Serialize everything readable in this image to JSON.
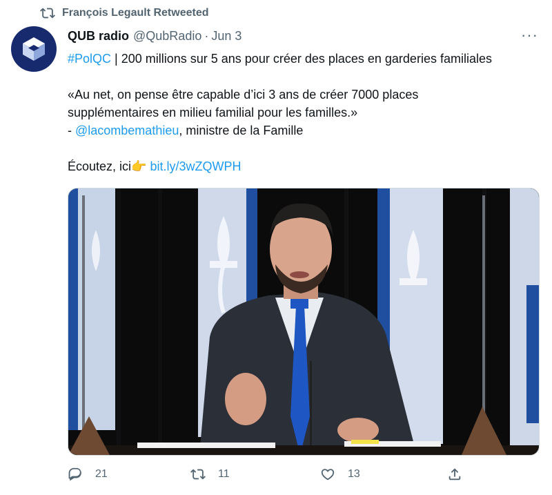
{
  "retweet": {
    "text": "François Legault Retweeted",
    "icon": "retweet-icon"
  },
  "author": {
    "name": "QUB radio",
    "handle": "@QubRadio",
    "separator": "·",
    "date": "Jun 3"
  },
  "tweet": {
    "line1_hashtag": "#PolQC",
    "line1_text": " | 200 millions sur 5 ans pour créer des places en garderies familiales",
    "quote_line1": "«Au net, on pense être capable d’ici 3 ans de créer 7000 places",
    "quote_line2": "supplémentaires en milieu familial pour les familles.»",
    "attribution_prefix": "- ",
    "mention": "@lacombemathieu",
    "attribution_suffix": ", ministre de la Famille",
    "listen_text": "Écoutez, ici",
    "listen_emoji": "👉",
    "link": "bit.ly/3wZQWPH"
  },
  "actions": {
    "reply_count": "21",
    "retweet_count": "11",
    "like_count": "13"
  },
  "colors": {
    "link": "#1d9bf0",
    "muted": "#536471",
    "avatar_bg": "#172a6e"
  }
}
